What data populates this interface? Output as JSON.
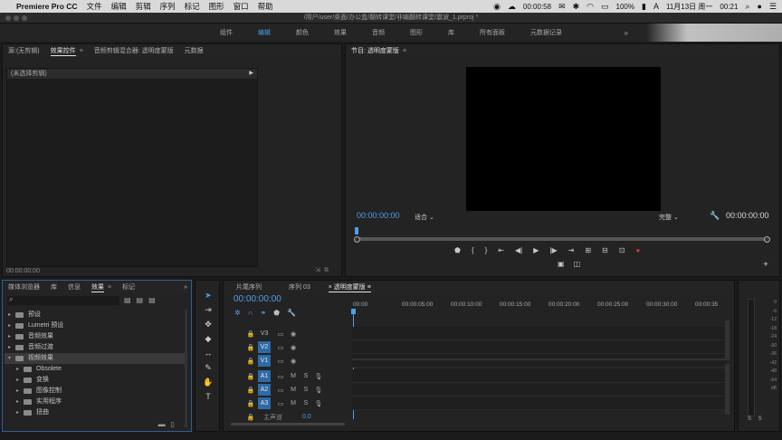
{
  "menubar": {
    "app_name": "Premiere Pro CC",
    "menus": [
      "文件",
      "编辑",
      "剪辑",
      "序列",
      "标记",
      "图形",
      "窗口",
      "帮助"
    ],
    "timer": "00:00:58",
    "battery": "100%",
    "datetime": "11月13日 周一",
    "time": "00:21"
  },
  "titlebar": {
    "path": "/用户/user/桌面/办公盒/翻转课堂/非编翻转课堂/震波_1.prproj *"
  },
  "workspaces": {
    "tabs": [
      "组件",
      "编辑",
      "颜色",
      "效果",
      "音频",
      "图形",
      "库",
      "所有面板",
      "元数据记录"
    ],
    "active_index": 1,
    "more": "»"
  },
  "source_panel": {
    "tabs": [
      "源:(无剪辑)",
      "效果控件",
      "音频剪辑混合器: 透明度蒙版",
      "元数据"
    ],
    "active_index": 1,
    "no_clip_label": "(未选择剪辑)",
    "timecode": "00:00:00:00"
  },
  "program_panel": {
    "title": "节目: 透明度蒙版",
    "timecode_left": "00:00:00:00",
    "fit_select": "适合",
    "quality_select": "完整",
    "timecode_right": "00:00:00:00"
  },
  "effects_panel": {
    "tabs": [
      "媒体浏览器",
      "库",
      "信息",
      "效果",
      "标记"
    ],
    "active_index": 3,
    "search_placeholder": "",
    "tree": [
      {
        "label": "预设",
        "level": 0,
        "expanded": false
      },
      {
        "label": "Lumetri 预设",
        "level": 0,
        "expanded": false
      },
      {
        "label": "音频效果",
        "level": 0,
        "expanded": false
      },
      {
        "label": "音频过渡",
        "level": 0,
        "expanded": false
      },
      {
        "label": "视频效果",
        "level": 0,
        "expanded": true,
        "selected": true
      },
      {
        "label": "Obsolete",
        "level": 1,
        "expanded": false
      },
      {
        "label": "变换",
        "level": 1,
        "expanded": false
      },
      {
        "label": "图像控制",
        "level": 1,
        "expanded": false
      },
      {
        "label": "实用程序",
        "level": 1,
        "expanded": false
      },
      {
        "label": "扭曲",
        "level": 1,
        "expanded": false
      }
    ]
  },
  "timeline": {
    "tabs": [
      "片尾序列",
      "序列 03",
      "透明度蒙版"
    ],
    "active_index": 2,
    "timecode": "00:00:00:00",
    "ruler": [
      "00:00",
      "00:00:05:00",
      "00:00:10:00",
      "00:00:15:00",
      "00:00:20:00",
      "00:00:25:00",
      "00:00:30:00",
      "00:00:35"
    ],
    "video_tracks": [
      {
        "name": "V3",
        "enabled": false
      },
      {
        "name": "V2",
        "enabled": true
      },
      {
        "name": "V1",
        "enabled": true
      }
    ],
    "audio_tracks": [
      {
        "name": "A1",
        "enabled": true,
        "m": "M",
        "s": "S"
      },
      {
        "name": "A2",
        "enabled": true,
        "m": "M",
        "s": "S"
      },
      {
        "name": "A3",
        "enabled": true,
        "m": "M",
        "s": "S"
      }
    ],
    "master_label": "主声道",
    "master_value": "0.0"
  },
  "meter": {
    "scale": [
      "0",
      "-6",
      "-12",
      "-18",
      "-24",
      "-30",
      "-36",
      "-42",
      "-48",
      "-54",
      "dB"
    ],
    "solo_labels": "S S"
  },
  "colors": {
    "accent": "#4e9fe8",
    "track_on": "#2e6aa6",
    "record": "#c04040"
  }
}
